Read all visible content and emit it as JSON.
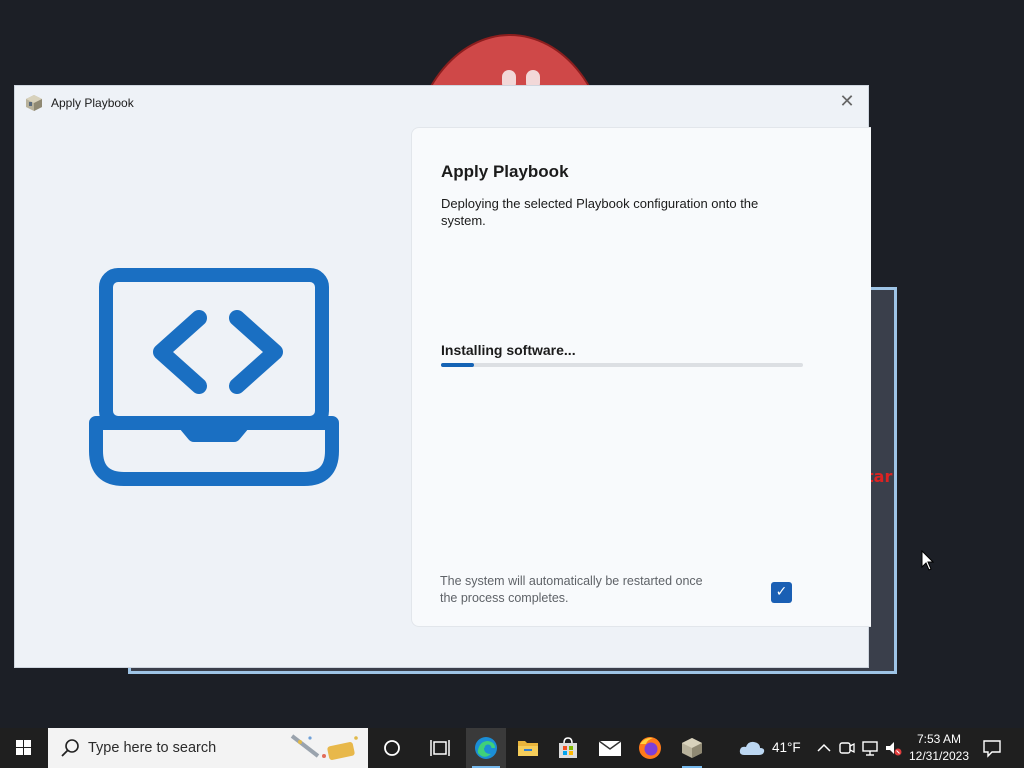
{
  "window": {
    "title": "Apply Playbook",
    "close_glyph": "✕"
  },
  "panel": {
    "title": "Apply Playbook",
    "description": "Deploying the selected Playbook configuration onto the system.",
    "status": "Installing software...",
    "progress_percent": 9,
    "footnote": "The system will automatically be restarted once the process completes.",
    "restart_checked": true,
    "check_glyph": "✓"
  },
  "background": {
    "partial_text": "tar"
  },
  "taskbar": {
    "search_placeholder": "Type here to search",
    "weather_temp": "41°F",
    "time": "7:53 AM",
    "date": "12/31/2023",
    "icons": [
      "windows-start-icon",
      "search-icon",
      "cortana-icon",
      "task-view-icon",
      "edge-icon",
      "file-explorer-icon",
      "microsoft-store-icon",
      "mail-icon",
      "firefox-icon",
      "playbook-app-icon",
      "weather-cloud-icon",
      "tray-chevron-icon",
      "network-icon",
      "monitor-icon",
      "volume-muted-icon",
      "notification-icon"
    ]
  },
  "colors": {
    "accent": "#1563b5",
    "hero_icon": "#1a6fc2",
    "taskbar": "#1f1f1f"
  }
}
